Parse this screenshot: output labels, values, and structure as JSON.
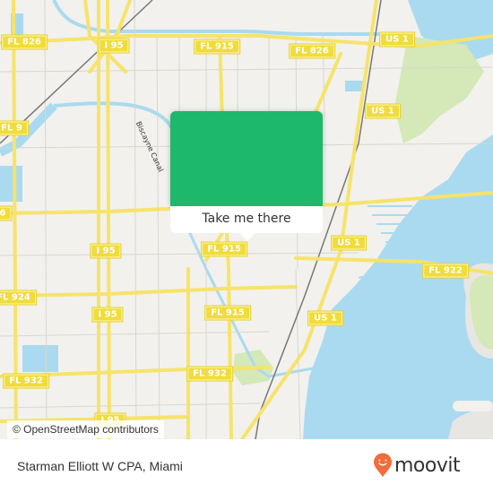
{
  "map": {
    "attribution": "© OpenStreetMap contributors",
    "canal_label": "Biscayne Canal",
    "road_shields": [
      {
        "id": "fl826-west",
        "label": "FL 826"
      },
      {
        "id": "i95-north",
        "label": "I 95"
      },
      {
        "id": "fl915-north",
        "label": "FL 915"
      },
      {
        "id": "fl826-east",
        "label": "FL 826"
      },
      {
        "id": "us1-north",
        "label": "US 1"
      },
      {
        "id": "fl9",
        "label": "FL 9"
      },
      {
        "id": "us1-mid",
        "label": "US 1"
      },
      {
        "id": "fl6",
        "label": "6"
      },
      {
        "id": "i95-mid",
        "label": "I 95"
      },
      {
        "id": "fl915-mid",
        "label": "FL 915"
      },
      {
        "id": "us1-east",
        "label": "US 1"
      },
      {
        "id": "fl922",
        "label": "FL 922"
      },
      {
        "id": "fl924",
        "label": "FL 924"
      },
      {
        "id": "i95-south",
        "label": "I 95"
      },
      {
        "id": "fl915-south",
        "label": "FL 915"
      },
      {
        "id": "us1-south",
        "label": "US 1"
      },
      {
        "id": "fl932-west",
        "label": "FL 932"
      },
      {
        "id": "fl932-east",
        "label": "FL 932"
      },
      {
        "id": "i95-bottom",
        "label": "I 95"
      }
    ],
    "colors": {
      "land": "#f2f1ed",
      "water": "#aadaef",
      "park": "#d4e8b8",
      "major_road": "#f6e36a",
      "shield": "#f0dc3c",
      "popup_accent": "#1db86b"
    }
  },
  "popup": {
    "cta_label": "Take me there"
  },
  "footer": {
    "place_name": "Starman Elliott W CPA, Miami",
    "brand": "moovit",
    "brand_color": "#f26b3a"
  }
}
